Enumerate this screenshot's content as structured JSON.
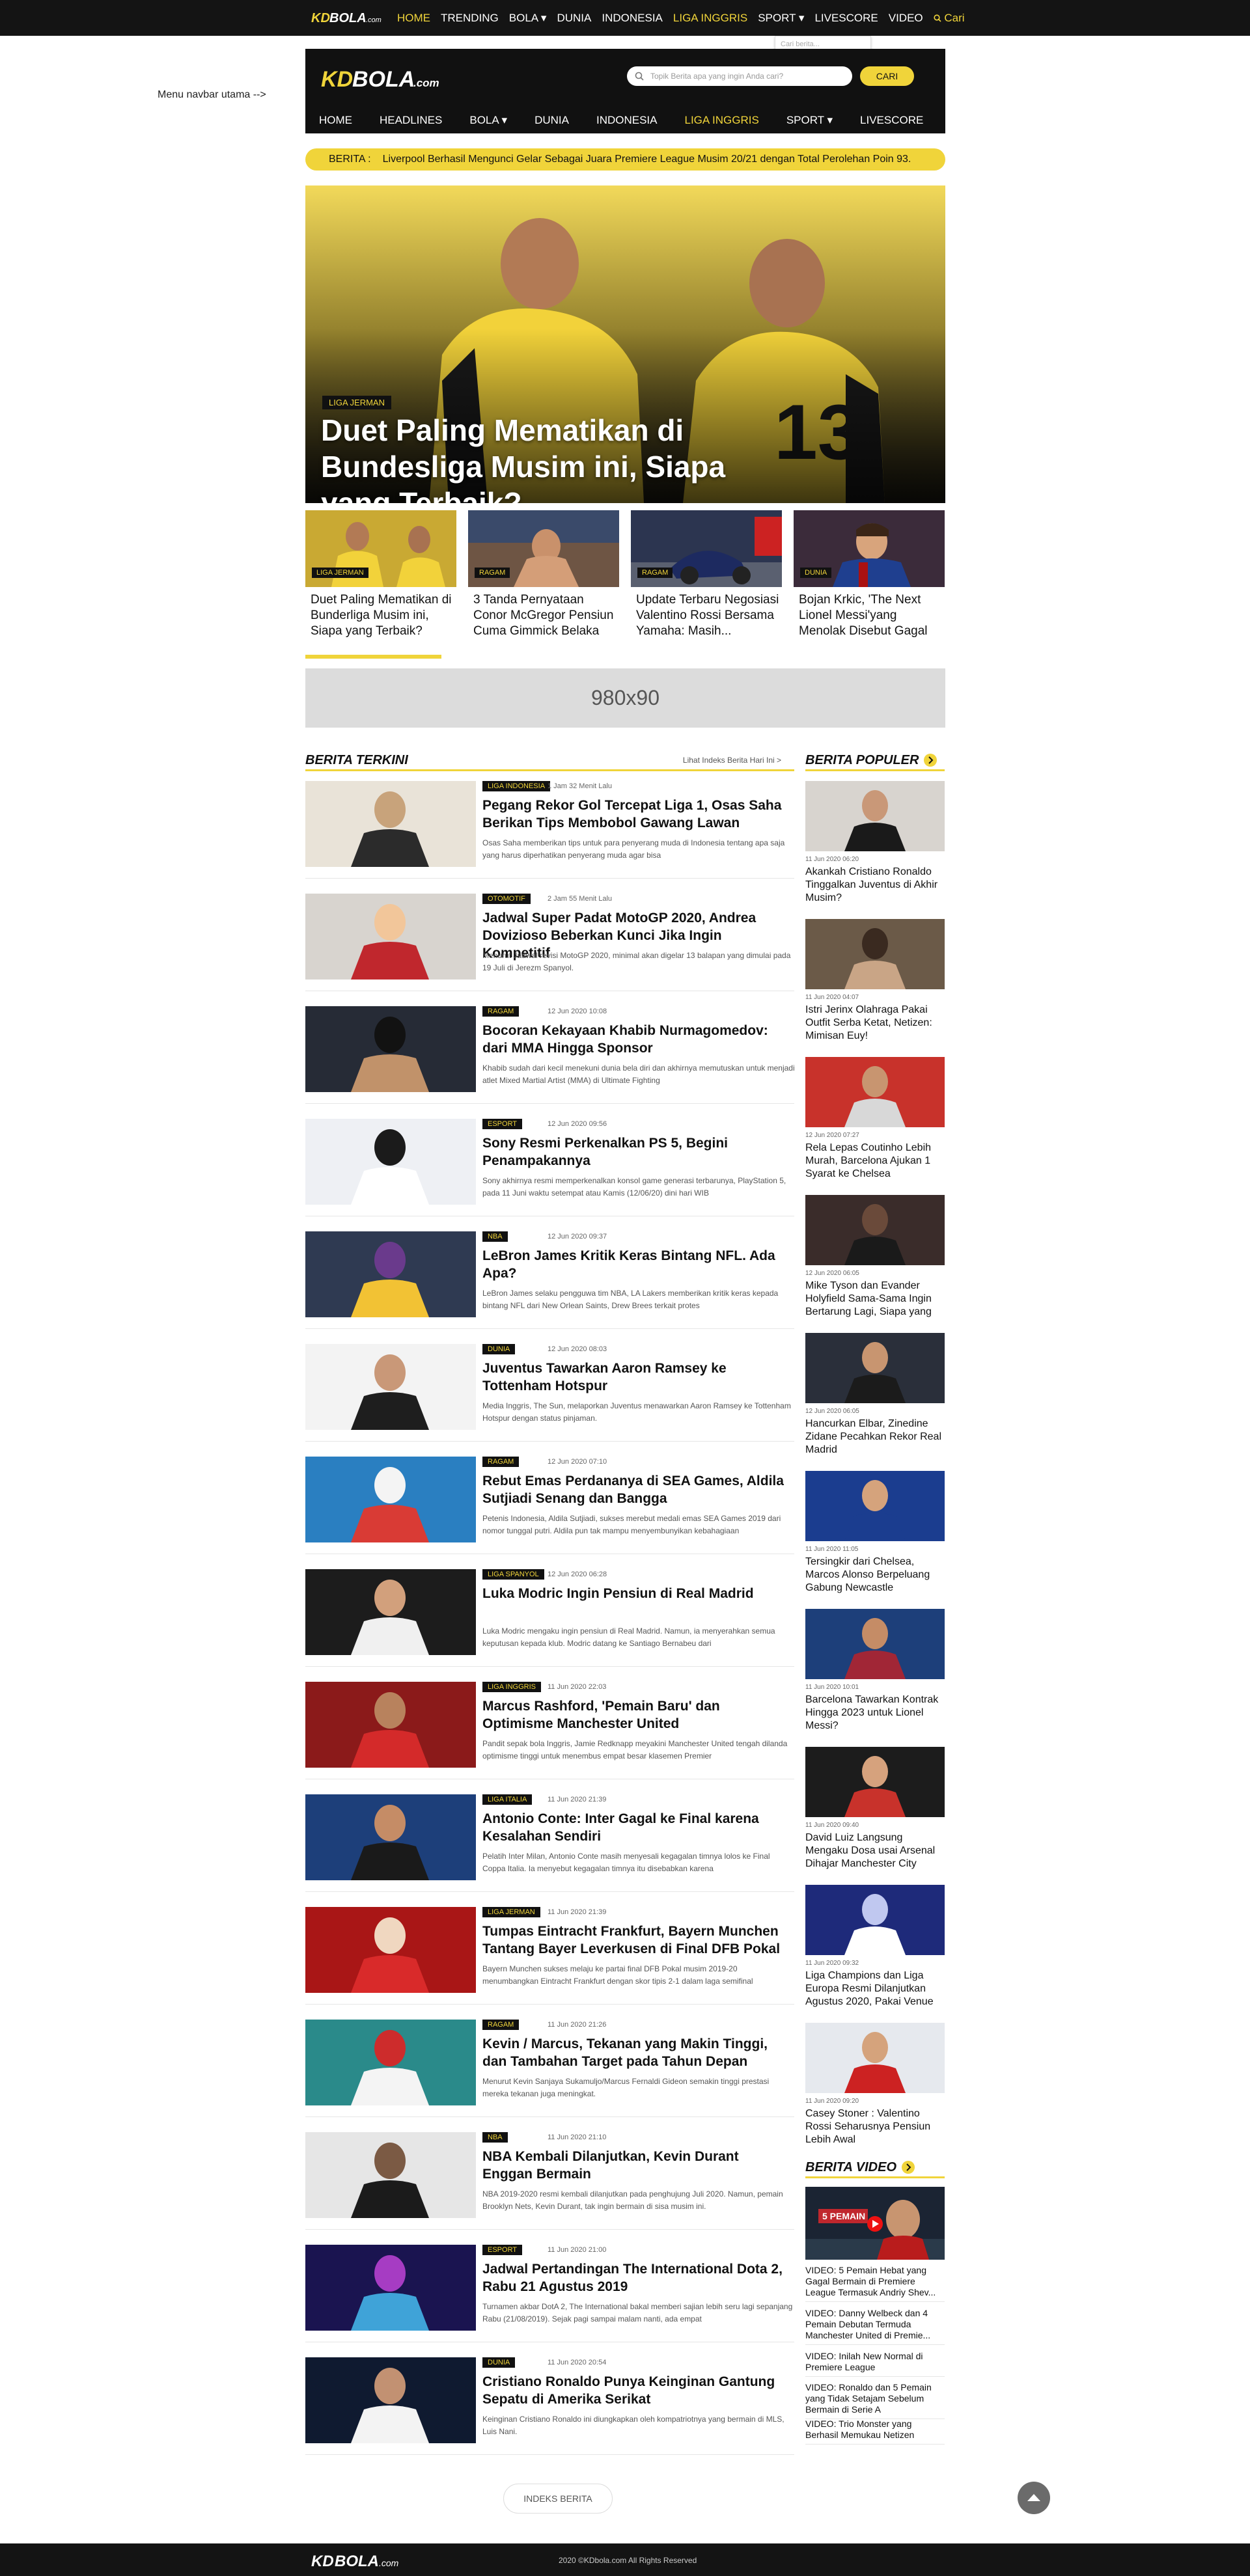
{
  "topbar": {
    "logo": "KDBOLA.com",
    "nav": [
      "HOME",
      "TRENDING",
      "BOLA ▾",
      "DUNIA",
      "INDONESIA",
      "LIGA INGGRIS",
      "SPORT ▾",
      "LIVESCORE",
      "VIDEO"
    ],
    "search_label": "Cari",
    "search_placeholder": "Cari berita..."
  },
  "menu_label": "Menu navbar utama -->",
  "header": {
    "logo": "KDBOLA.com",
    "search_placeholder": "Topik Berita apa yang ingin Anda cari?",
    "search_button": "CARI",
    "nav": [
      "HOME",
      "HEADLINES",
      "BOLA ▾",
      "DUNIA",
      "INDONESIA",
      "LIGA INGGRIS",
      "SPORT ▾",
      "LIVESCORE",
      "VIDEO"
    ]
  },
  "ticker": {
    "label": "BERITA :",
    "text": "Liverpool Berhasil Mengunci Gelar Sebagai Juara Premiere League Musim 20/21 dengan Total Perolehan Poin 93."
  },
  "hero": {
    "tag": "LIGA JERMAN",
    "title": "Duet Paling Mematikan di Bundesliga Musim ini, Siapa yang Terbaik?"
  },
  "thumbs": [
    {
      "tag": "LIGA JERMAN",
      "title": "Duet Paling Mematikan di Bunderliga Musim ini, Siapa yang Terbaik?",
      "progress": 0.9
    },
    {
      "tag": "RAGAM",
      "title": "3 Tanda Pernyataan Conor McGregor Pensiun Cuma Gimmick Belaka",
      "progress": 0
    },
    {
      "tag": "RAGAM",
      "title": "Update Terbaru Negosiasi Valentino Rossi Bersama Yamaha: Masih...",
      "progress": 0
    },
    {
      "tag": "DUNIA",
      "title": "Bojan Krkic, 'The Next Lionel Messi'yang Menolak Disebut Gagal",
      "progress": 0
    }
  ],
  "ad_label": "980x90",
  "terkini": {
    "heading": "BERITA TERKINI",
    "more": "Lihat Indeks Berita Hari Ini  >",
    "articles": [
      {
        "tag": "LIGA INDONESIA",
        "time": "1 Jam 32 Menit Lalu",
        "title": "Pegang Rekor Gol Tercepat Liga 1, Osas Saha Berikan Tips Membobol Gawang Lawan",
        "desc": "Osas Saha memberikan tips untuk para penyerang muda di Indonesia tentang apa saja yang harus diperhatikan penyerang muda agar bisa"
      },
      {
        "tag": "OTOMOTIF",
        "time": "2 Jam 55 Menit Lalu",
        "title": "Jadwal Super Padat MotoGP 2020, Andrea Dovizioso Beberkan Kunci Jika Ingin Kompetitif",
        "desc": "Menurut Jadwal revisi MotoGP 2020, minimal akan digelar 13 balapan yang dimulai pada 19 Juli di Jerezm Spanyol."
      },
      {
        "tag": "RAGAM",
        "time": "12 Jun 2020 10:08",
        "title": "Bocoran Kekayaan Khabib Nurmagomedov: dari MMA Hingga Sponsor",
        "desc": "Khabib sudah dari kecil menekuni dunia bela diri dan akhirnya memutuskan untuk menjadi atlet Mixed Martial Artist (MMA) di Ultimate Fighting"
      },
      {
        "tag": "ESPORT",
        "time": "12 Jun 2020 09:56",
        "title": "Sony Resmi Perkenalkan PS 5, Begini Penampakannya",
        "desc": "Sony akhirnya resmi memperkenalkan konsol game generasi terbarunya, PlayStation 5, pada 11 Juni waktu setempat atau Kamis (12/06/20) dini hari WIB"
      },
      {
        "tag": "NBA",
        "time": "12 Jun 2020 09:37",
        "title": "LeBron James Kritik Keras Bintang NFL. Ada Apa?",
        "desc": "LeBron James selaku pengguwa tim NBA, LA Lakers memberikan kritik keras kepada bintang NFL dari New Orlean Saints, Drew Brees terkait protes"
      },
      {
        "tag": "DUNIA",
        "time": "12 Jun 2020 08:03",
        "title": "Juventus Tawarkan Aaron Ramsey ke Tottenham Hotspur",
        "desc": "Media Inggris, The Sun, melaporkan Juventus menawarkan Aaron Ramsey ke Tottenham Hotspur dengan status pinjaman."
      },
      {
        "tag": "RAGAM",
        "time": "12 Jun 2020 07:10",
        "title": "Rebut Emas Perdananya di SEA Games, Aldila Sutjiadi Senang dan Bangga",
        "desc": "Petenis Indonesia, Aldila Sutjiadi, sukses merebut medali emas SEA Games 2019 dari nomor tunggal putri. Aldila pun tak mampu menyembunyikan kebahagiaan"
      },
      {
        "tag": "LIGA SPANYOL",
        "time": "12 Jun 2020 06:28",
        "title": "Luka Modric Ingin Pensiun di Real Madrid",
        "desc": "Luka Modric mengaku ingin pensiun di Real Madrid. Namun, ia menyerahkan semua keputusan kepada klub. Modric datang ke Santiago Bernabeu dari"
      },
      {
        "tag": "LIGA INGGRIS",
        "time": "11 Jun 2020 22:03",
        "title": "Marcus Rashford, 'Pemain Baru' dan Optimisme Manchester United",
        "desc": "Pandit sepak bola Inggris, Jamie Redknapp meyakini Manchester United tengah dilanda optimisme tinggi untuk menembus empat besar klasemen Premier"
      },
      {
        "tag": "LIGA ITALIA",
        "time": "11 Jun 2020 21:39",
        "title": "Antonio Conte: Inter Gagal ke Final karena Kesalahan Sendiri",
        "desc": "Pelatih Inter Milan, Antonio Conte masih menyesali kegagalan timnya lolos ke Final Coppa Italia. Ia menyebut kegagalan timnya itu disebabkan karena"
      },
      {
        "tag": "LIGA JERMAN",
        "time": "11 Jun 2020 21:39",
        "title": "Tumpas Eintracht Frankfurt, Bayern Munchen Tantang Bayer Leverkusen di Final DFB Pokal",
        "desc": "Bayern Munchen sukses melaju ke partai final DFB Pokal musim 2019-20 menumbangkan Eintracht Frankfurt dengan skor tipis 2-1 dalam laga semifinal"
      },
      {
        "tag": "RAGAM",
        "time": "11 Jun 2020 21:26",
        "title": "Kevin / Marcus, Tekanan yang Makin Tinggi, dan Tambahan Target pada Tahun Depan",
        "desc": "Menurut Kevin Sanjaya Sukamuljo/Marcus Fernaldi Gideon semakin tinggi prestasi mereka tekanan juga meningkat."
      },
      {
        "tag": "NBA",
        "time": "11 Jun 2020 21:10",
        "title": "NBA Kembali Dilanjutkan, Kevin Durant Enggan Bermain",
        "desc": "NBA 2019-2020 resmi kembali dilanjutkan pada penghujung Juli 2020. Namun, pemain Brooklyn Nets, Kevin Durant, tak ingin bermain di sisa musim ini."
      },
      {
        "tag": "ESPORT",
        "time": "11 Jun 2020 21:00",
        "title": "Jadwal Pertandingan The International Dota 2, Rabu 21 Agustus 2019",
        "desc": "Turnamen akbar DotA 2, The International bakal memberi sajian lebih seru lagi sepanjang Rabu (21/08/2019). Sejak pagi sampai malam nanti, ada empat"
      },
      {
        "tag": "DUNIA",
        "time": "11 Jun 2020 20:54",
        "title": "Cristiano Ronaldo Punya Keinginan Gantung Sepatu di Amerika Serikat",
        "desc": "Keinginan Cristiano Ronaldo ini diungkapkan oleh kompatriotnya yang bermain di MLS, Luis Nani."
      }
    ]
  },
  "populer": {
    "heading": "BERITA POPULER",
    "items": [
      {
        "time": "11 Jun 2020 06:20",
        "title": "Akankah Cristiano Ronaldo Tinggalkan Juventus di Akhir Musim?"
      },
      {
        "time": "11 Jun 2020 04:07",
        "title": "Istri Jerinx Olahraga Pakai Outfit Serba Ketat, Netizen: Mimisan Euy!"
      },
      {
        "time": "12 Jun 2020 07:27",
        "title": "Rela Lepas Coutinho Lebih Murah, Barcelona Ajukan 1 Syarat ke Chelsea"
      },
      {
        "time": "12 Jun 2020 06:05",
        "title": "Mike Tyson dan Evander Holyfield Sama-Sama Ingin Bertarung Lagi, Siapa yang"
      },
      {
        "time": "12 Jun 2020 06:05",
        "title": "Hancurkan Elbar, Zinedine Zidane Pecahkan Rekor Real Madrid"
      },
      {
        "time": "11 Jun 2020 11:05",
        "title": "Tersingkir dari Chelsea, Marcos Alonso Berpeluang Gabung Newcastle"
      },
      {
        "time": "11 Jun 2020 10:01",
        "title": "Barcelona Tawarkan Kontrak Hingga 2023 untuk Lionel Messi?"
      },
      {
        "time": "11 Jun 2020 09:40",
        "title": "David Luiz Langsung Mengaku Dosa usai Arsenal Dihajar Manchester City"
      },
      {
        "time": "11 Jun 2020 09:32",
        "title": "Liga Champions dan Liga Europa Resmi Dilanjutkan Agustus 2020, Pakai Venue"
      },
      {
        "time": "11 Jun 2020 09:20",
        "title": "Casey Stoner : Valentino Rossi Seharusnya Pensiun Lebih Awal"
      }
    ]
  },
  "video": {
    "heading": "BERITA VIDEO",
    "items": [
      "VIDEO: 5 Pemain Hebat yang Gagal Bermain di Premiere League Termasuk Andriy Shev...",
      "VIDEO: Danny Welbeck dan 4 Pemain Debutan Termuda Manchester United di Premie...",
      "VIDEO: Inilah New Normal di Premiere League",
      "VIDEO: Ronaldo dan 5 Pemain yang Tidak Setajam Sebelum Bermain di Serie A",
      "VIDEO: Trio Monster yang Berhasil Memukau Netizen"
    ]
  },
  "indeks_button": "INDEKS BERITA",
  "footer": {
    "logo": "KDBOLA.com",
    "copyright": "2020 ©KDbola.com All Rights Reserved"
  },
  "colors": {
    "accent": "#f0d43a",
    "dark": "#141414"
  }
}
